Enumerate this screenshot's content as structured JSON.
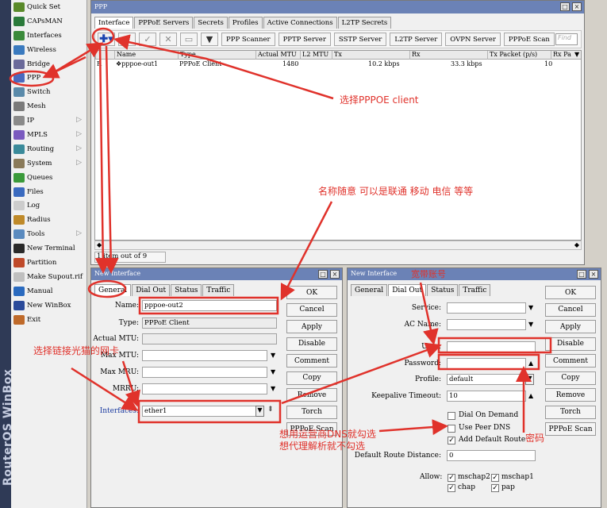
{
  "brand": "RouterOS WinBox",
  "sidebar": {
    "items": [
      {
        "label": "Quick Set",
        "icon": "quick-set-icon",
        "color": "#5a8a2a",
        "submenu": false
      },
      {
        "label": "CAPsMAN",
        "icon": "capsman-icon",
        "color": "#2a7a3a",
        "submenu": false
      },
      {
        "label": "Interfaces",
        "icon": "interfaces-icon",
        "color": "#3a8a3a",
        "submenu": false
      },
      {
        "label": "Wireless",
        "icon": "wireless-icon",
        "color": "#3a7abf",
        "submenu": false
      },
      {
        "label": "Bridge",
        "icon": "bridge-icon",
        "color": "#6a6a9a",
        "submenu": false
      },
      {
        "label": "PPP",
        "icon": "ppp-icon",
        "color": "#4a6abf",
        "submenu": false
      },
      {
        "label": "Switch",
        "icon": "switch-icon",
        "color": "#5a8aaa",
        "submenu": false
      },
      {
        "label": "Mesh",
        "icon": "mesh-icon",
        "color": "#7a7a7a",
        "submenu": false
      },
      {
        "label": "IP",
        "icon": "ip-icon",
        "color": "#8a8a8a",
        "submenu": true
      },
      {
        "label": "MPLS",
        "icon": "mpls-icon",
        "color": "#7a5abf",
        "submenu": true
      },
      {
        "label": "Routing",
        "icon": "routing-icon",
        "color": "#3a8a9a",
        "submenu": true
      },
      {
        "label": "System",
        "icon": "system-icon",
        "color": "#8a7a5a",
        "submenu": true
      },
      {
        "label": "Queues",
        "icon": "queues-icon",
        "color": "#3a9a3a",
        "submenu": false
      },
      {
        "label": "Files",
        "icon": "files-icon",
        "color": "#3a6abf",
        "submenu": false
      },
      {
        "label": "Log",
        "icon": "log-icon",
        "color": "#cccccc",
        "submenu": false
      },
      {
        "label": "Radius",
        "icon": "radius-icon",
        "color": "#bf8a2a",
        "submenu": false
      },
      {
        "label": "Tools",
        "icon": "tools-icon",
        "color": "#5a8abf",
        "submenu": true
      },
      {
        "label": "New Terminal",
        "icon": "terminal-icon",
        "color": "#2a2a2a",
        "submenu": false
      },
      {
        "label": "Partition",
        "icon": "partition-icon",
        "color": "#bf4a2a",
        "submenu": false
      },
      {
        "label": "Make Supout.rif",
        "icon": "supout-icon",
        "color": "#bfbfbf",
        "submenu": false
      },
      {
        "label": "Manual",
        "icon": "manual-icon",
        "color": "#2a6abf",
        "submenu": false
      },
      {
        "label": "New WinBox",
        "icon": "winbox-icon",
        "color": "#2a4a9a",
        "submenu": false
      },
      {
        "label": "Exit",
        "icon": "exit-icon",
        "color": "#bf6a2a",
        "submenu": false
      }
    ]
  },
  "ppp": {
    "title": "PPP",
    "tabs": [
      "Interface",
      "PPPoE Servers",
      "Secrets",
      "Profiles",
      "Active Connections",
      "L2TP Secrets"
    ],
    "toolbar": {
      "buttons": [
        "PPP Scanner",
        "PPTP Server",
        "SSTP Server",
        "L2TP Server",
        "OVPN Server",
        "PPPoE Scan"
      ],
      "find_placeholder": "Find"
    },
    "columns": [
      "Name",
      "Type",
      "Actual MTU",
      "L2 MTU",
      "Tx",
      "Rx",
      "Tx Packet (p/s)",
      "Rx Pa"
    ],
    "rows": [
      {
        "flag": "R",
        "name": "❖pppoe-out1",
        "type": "PPPoE Client",
        "actual_mtu": "1480",
        "l2_mtu": "",
        "tx": "10.2 kbps",
        "rx": "33.3 kbps",
        "tx_packet": "10",
        "rx_packet": ""
      }
    ],
    "status": "1 item out of 9"
  },
  "dialog1": {
    "title": "New Interface",
    "tabs": [
      "General",
      "Dial Out",
      "Status",
      "Traffic"
    ],
    "fields": {
      "name_label": "Name:",
      "name_value": "pppoe-out2",
      "type_label": "Type:",
      "type_value": "PPPoE Client",
      "actual_mtu_label": "Actual MTU:",
      "actual_mtu_value": "",
      "max_mtu_label": "Max MTU:",
      "max_mtu_value": "",
      "max_mru_label": "Max MRU:",
      "max_mru_value": "",
      "mrru_label": "MRRU:",
      "mrru_value": "",
      "interfaces_label": "Interfaces:",
      "interfaces_value": "ether1"
    },
    "buttons": [
      "OK",
      "Cancel",
      "Apply",
      "Disable",
      "Comment",
      "Copy",
      "Remove",
      "Torch",
      "PPPoE Scan"
    ]
  },
  "dialog2": {
    "title": "New Interface",
    "tabs": [
      "General",
      "Dial Out",
      "Status",
      "Traffic"
    ],
    "fields": {
      "service_label": "Service:",
      "service_value": "",
      "ac_name_label": "AC Name:",
      "ac_name_value": "",
      "user_label": "User:",
      "user_value": "",
      "password_label": "Password:",
      "password_value": "",
      "profile_label": "Profile:",
      "profile_value": "default",
      "keepalive_label": "Keepalive Timeout:",
      "keepalive_value": "10",
      "dial_on_demand_label": "Dial On Demand",
      "dial_on_demand": false,
      "use_peer_dns_label": "Use Peer DNS",
      "use_peer_dns": false,
      "add_default_route_label": "Add Default Route",
      "add_default_route": true,
      "default_route_distance_label": "Default Route Distance:",
      "default_route_distance_value": "0",
      "allow_label": "Allow:",
      "allow": [
        {
          "label": "mschap2",
          "checked": true
        },
        {
          "label": "mschap1",
          "checked": true
        },
        {
          "label": "chap",
          "checked": true
        },
        {
          "label": "pap",
          "checked": true
        }
      ]
    },
    "buttons": [
      "OK",
      "Cancel",
      "Apply",
      "Disable",
      "Comment",
      "Copy",
      "Remove",
      "Torch",
      "PPPoE Scan"
    ]
  },
  "annotations": {
    "select_pppoe_client": "选择PPPOE client",
    "name_any": "名称随意  可以是联通  移动  电信  等等",
    "select_interface": "选择链接光猫的网卡",
    "broadband_account": "宽带账号",
    "password": "密码",
    "dns_line1": "想用运营商DNS就勾选",
    "dns_line2": "想代理解析就不勾选"
  },
  "colors": {
    "annotation": "#e0322b",
    "title_bar": "#6b82b6",
    "brand_strip": "#2f3a56"
  }
}
